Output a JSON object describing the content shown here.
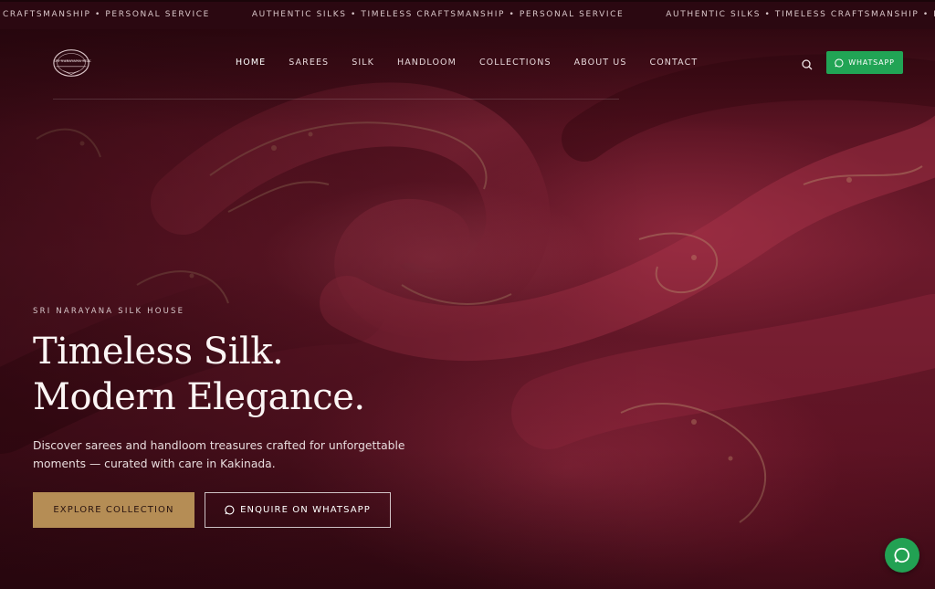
{
  "marquee": {
    "items": [
      "LESS CRAFTSMANSHIP • PERSONAL SERVICE",
      "AUTHENTIC SILKS • TIMELESS CRAFTSMANSHIP • PERSONAL SERVICE",
      "AUTHENTIC SILKS • TIMELESS CRAFTSMANSHIP • PERSONAL SERVICE"
    ]
  },
  "brand": {
    "logo_text": "SRI NARAYANA SILK"
  },
  "nav": {
    "items": [
      {
        "label": "HOME",
        "active": true
      },
      {
        "label": "SAREES"
      },
      {
        "label": "SILK"
      },
      {
        "label": "HANDLOOM"
      },
      {
        "label": "COLLECTIONS"
      },
      {
        "label": "ABOUT US"
      },
      {
        "label": "CONTACT"
      }
    ],
    "search_icon": "search-icon",
    "whatsapp_label": "WHATSAPP"
  },
  "hero": {
    "eyebrow": "SRI NARAYANA SILK HOUSE",
    "headline_line1": "Timeless Silk.",
    "headline_line2": "Modern Elegance.",
    "lede": "Discover sarees and handloom treasures crafted for unforgettable moments — curated with care in Kakinada.",
    "primary_cta": "EXPLORE COLLECTION",
    "secondary_cta": "ENQUIRE ON WHATSAPP"
  },
  "floating": {
    "icon": "chat-icon"
  },
  "colors": {
    "maroon": "#5c1424",
    "gold": "#b58d55",
    "whatsapp_green": "#21a455"
  }
}
